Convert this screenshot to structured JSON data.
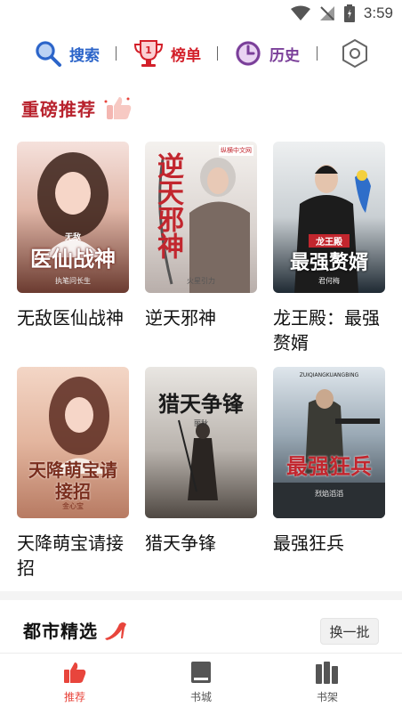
{
  "status_bar": {
    "time": "3:59"
  },
  "top_nav": [
    {
      "label": "搜索",
      "icon": "search-icon"
    },
    {
      "label": "榜单",
      "icon": "trophy-icon",
      "badge": "1"
    },
    {
      "label": "历史",
      "icon": "clock-icon"
    },
    {
      "icon": "settings-hexagon-icon"
    }
  ],
  "featured_section": {
    "title": "重磅推荐",
    "icon": "thumbs-up-icon"
  },
  "books": [
    {
      "title": "无敌医仙战神",
      "cover_title": "医仙战神",
      "cover_sub": "无敌",
      "cover_author": "执笔问长生",
      "colors": [
        "#f3d9d6",
        "#6b3b30"
      ]
    },
    {
      "title": "逆天邪神",
      "cover_title": "逆天邪神",
      "cover_sub": "",
      "cover_author": "火星引力",
      "publisher": "纵横中文网",
      "colors": [
        "#f1ece8",
        "#bdb4b0"
      ]
    },
    {
      "title": "龙王殿：最强赘婿",
      "cover_title": "最强赘婿",
      "cover_sub": "龙王殿",
      "cover_author": "君何梅",
      "colors": [
        "#e4e8ea",
        "#2e3a44"
      ]
    },
    {
      "title": "天降萌宝请接招",
      "cover_title": "天降萌宝请接招",
      "cover_sub": "",
      "cover_author": "金心宝",
      "colors": [
        "#f0c9b2",
        "#8a4a3a"
      ]
    },
    {
      "title": "猎天争锋",
      "cover_title": "猎天争锋",
      "cover_sub": "",
      "cover_author": "丽秋",
      "colors": [
        "#d8d4ce",
        "#5d5650"
      ]
    },
    {
      "title": "最强狂兵",
      "cover_title": "最强狂兵",
      "cover_sub": "ZUIQIANGKUANGBING",
      "cover_author": "烈焰滔滔",
      "colors": [
        "#c6d4df",
        "#3b4a57"
      ]
    }
  ],
  "city_section": {
    "title": "都市精选",
    "icon": "high-heel-icon",
    "refresh_label": "换一批"
  },
  "tab_bar": [
    {
      "label": "推荐",
      "icon": "thumbs-up-icon",
      "active": true
    },
    {
      "label": "书城",
      "icon": "book-icon",
      "active": false
    },
    {
      "label": "书架",
      "icon": "bookshelf-icon",
      "active": false
    }
  ]
}
